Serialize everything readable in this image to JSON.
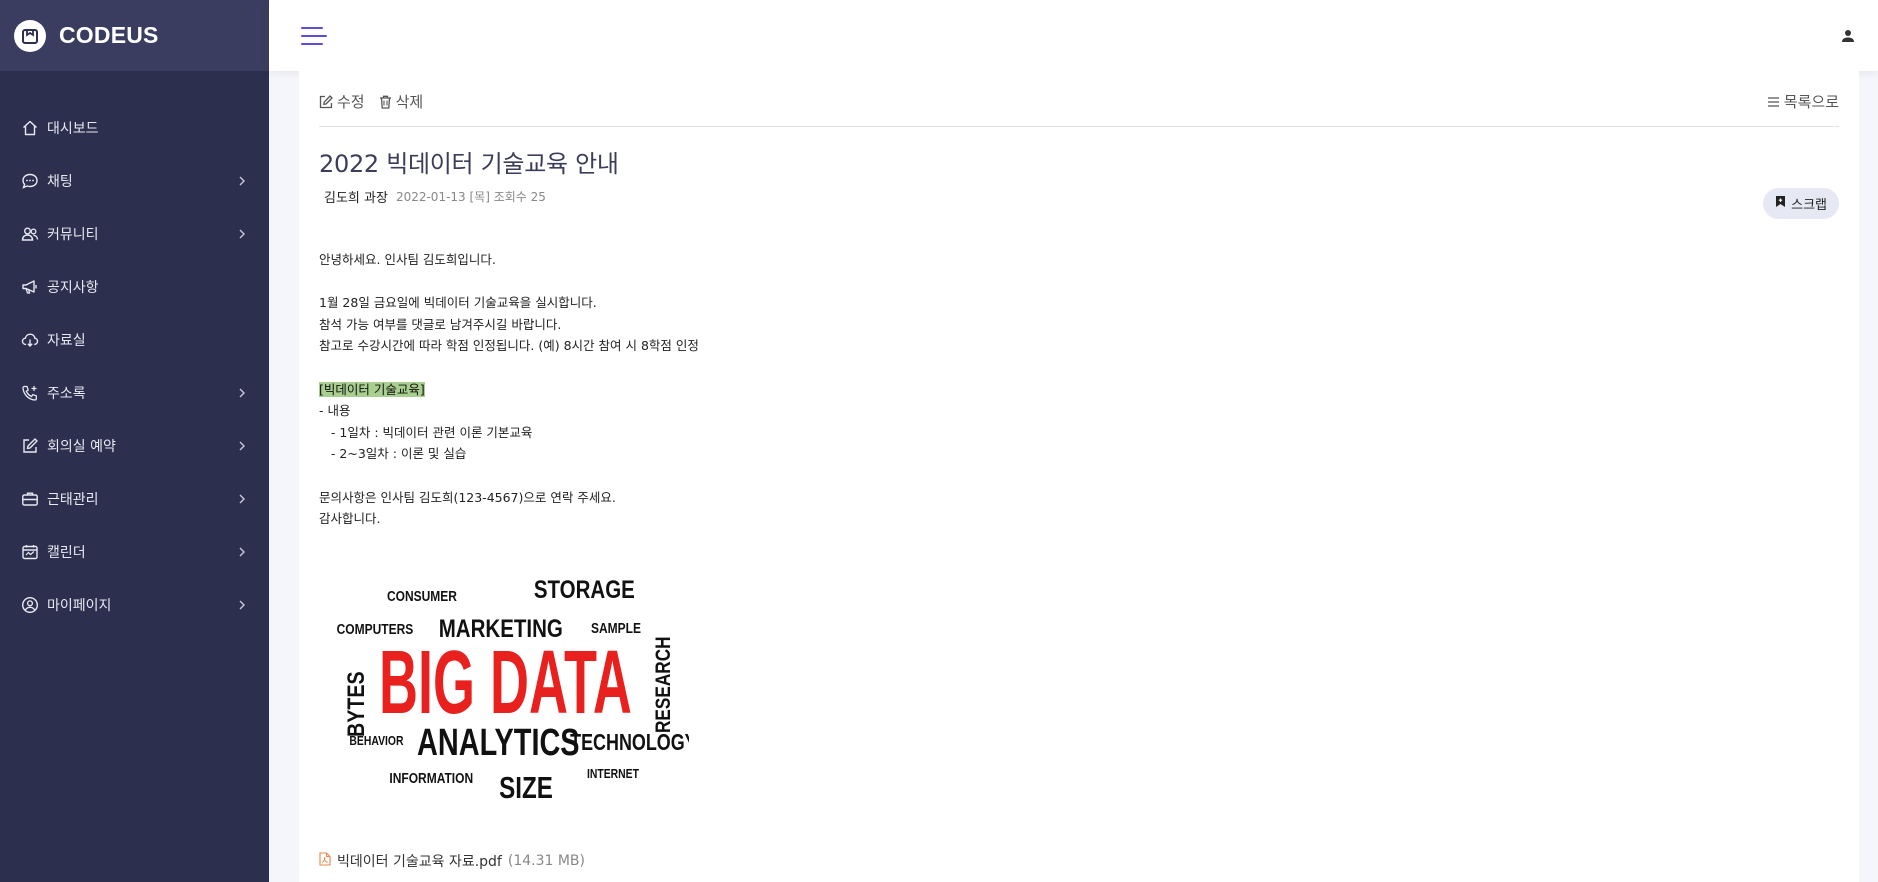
{
  "brand": {
    "name": "CODEUS"
  },
  "sidebar": {
    "items": [
      {
        "label": "대시보드",
        "icon": "home-icon",
        "has_submenu": false
      },
      {
        "label": "채팅",
        "icon": "chat-icon",
        "has_submenu": true
      },
      {
        "label": "커뮤니티",
        "icon": "users-icon",
        "has_submenu": true
      },
      {
        "label": "공지사항",
        "icon": "megaphone-icon",
        "has_submenu": false
      },
      {
        "label": "자료실",
        "icon": "cloud-download-icon",
        "has_submenu": false
      },
      {
        "label": "주소록",
        "icon": "phone-plus-icon",
        "has_submenu": true
      },
      {
        "label": "회의실 예약",
        "icon": "edit-icon",
        "has_submenu": true
      },
      {
        "label": "근태관리",
        "icon": "briefcase-icon",
        "has_submenu": true
      },
      {
        "label": "캘린더",
        "icon": "calendar-icon",
        "has_submenu": true
      },
      {
        "label": "마이페이지",
        "icon": "user-circle-icon",
        "has_submenu": true
      }
    ]
  },
  "toolbar": {
    "edit_label": "수정",
    "delete_label": "삭제",
    "list_label": "목록으로"
  },
  "post": {
    "title": "2022 빅데이터 기술교육 안내",
    "author": "김도희 과장",
    "meta": "2022-01-13 [목] 조회수 25",
    "scrap_label": "스크랩",
    "body": {
      "l1": "안녕하세요. 인사팀 김도희입니다.",
      "l2": "1월 28일 금요일에 빅데이터 기술교육을 실시합니다.",
      "l3": "참석 가능 여부를 댓글로 남겨주시길 바랍니다.",
      "l4": "참고로 수강시간에 따라 학점 인정됩니다. (예) 8시간 참여 시 8학점 인정",
      "l5": "[빅데이터 기술교육]",
      "l6": "- 내용",
      "l7": "   - 1일차 : 빅데이터 관련 이론 기본교육",
      "l8": "   - 2~3일차 : 이론 및 실습",
      "l9": "문의사항은 인사팀 김도희(123-4567)으로 연락 주세요.",
      "l10": "감사합니다."
    },
    "wordcloud": {
      "main": "BIG DATA",
      "words": [
        "CONSUMER",
        "STORAGE",
        "COMPUTERS",
        "MARKETING",
        "SAMPLE",
        "BYTES",
        "RESEARCH",
        "BEHAVIOR",
        "ANALYTICS",
        "TECHNOLOGY",
        "INFORMATION",
        "SIZE",
        "INTERNET"
      ]
    },
    "attachment": {
      "name": "빅데이터 기술교육 자료.pdf",
      "size": "(14.31 MB)"
    }
  },
  "colors": {
    "sidebar_bg": "#2d2f4e",
    "brand_bg": "#3a3d5f",
    "accent": "#5b4fd6",
    "highlight": "#a8cf8f",
    "wordcloud_red": "#e8211f"
  }
}
